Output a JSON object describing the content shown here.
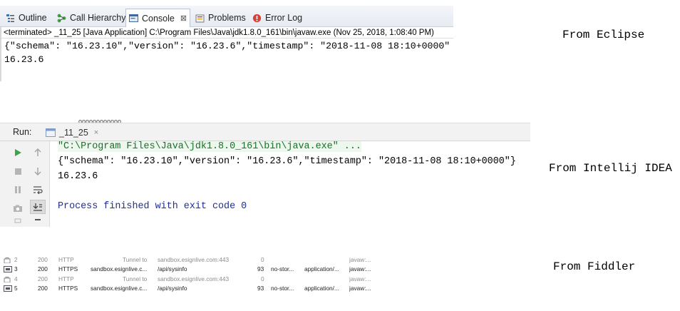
{
  "eclipse": {
    "tabs": [
      {
        "label": "Outline",
        "icon": "outline-icon",
        "active": false
      },
      {
        "label": "Call Hierarchy",
        "icon": "call-hierarchy-icon",
        "active": false
      },
      {
        "label": "Console",
        "icon": "console-icon",
        "active": true
      },
      {
        "label": "Problems",
        "icon": "problems-icon",
        "active": false
      },
      {
        "label": "Error Log",
        "icon": "error-log-icon",
        "active": false
      }
    ],
    "close_glyph": "⊠",
    "status_line": "<terminated> _11_25 [Java Application] C:\\Program Files\\Java\\jdk1.8.0_161\\bin\\javaw.exe (Nov 25, 2018, 1:08:40 PM)",
    "output": [
      "{\"schema\": \"16.23.10\",\"version\": \"16.23.6\",\"timestamp\": \"2018-11-08 18:10+0000\"",
      "16.23.6"
    ],
    "caption": "From Eclipse"
  },
  "idea": {
    "partial_text": "oooooooooooo",
    "run_label": "Run:",
    "tab_label": "_11_25",
    "tab_close": "×",
    "toolbar_icons": [
      "run-icon",
      "up-arrow-icon",
      "stop-icon",
      "down-arrow-icon",
      "pause-icon",
      "soft-wrap-icon",
      "camera-icon",
      "scroll-to-end-icon"
    ],
    "command_line": "\"C:\\Program Files\\Java\\jdk1.8.0_161\\bin\\java.exe\" ...",
    "output": [
      "{\"schema\": \"16.23.10\",\"version\": \"16.23.6\",\"timestamp\": \"2018-11-08 18:10+0000\"}",
      "16.23.6"
    ],
    "exit_line": "Process finished with exit code 0",
    "caption": "From Intellij IDEA",
    "colors": {
      "command": "#1a6f2a",
      "exit": "#1d2e9a",
      "run_green": "#3ca34a"
    }
  },
  "fiddler": {
    "rows": [
      {
        "num": "2",
        "result": "200",
        "protocol": "HTTP",
        "host": "Tunnel to",
        "url": "sandbox.esignlive.com:443",
        "body": "0",
        "caching": "",
        "content_type": "",
        "process": "javaw:...",
        "tunnel": true
      },
      {
        "num": "3",
        "result": "200",
        "protocol": "HTTPS",
        "host": "sandbox.esignlive.c...",
        "url": "/api/sysinfo",
        "body": "93",
        "caching": "no-stor...",
        "content_type": "application/...",
        "process": "javaw:...",
        "tunnel": false
      },
      {
        "num": "4",
        "result": "200",
        "protocol": "HTTP",
        "host": "Tunnel to",
        "url": "sandbox.esignlive.com:443",
        "body": "0",
        "caching": "",
        "content_type": "",
        "process": "javaw:...",
        "tunnel": true
      },
      {
        "num": "5",
        "result": "200",
        "protocol": "HTTPS",
        "host": "sandbox.esignlive.c...",
        "url": "/api/sysinfo",
        "body": "93",
        "caching": "no-stor...",
        "content_type": "application/...",
        "process": "javaw:...",
        "tunnel": false
      }
    ],
    "caption": "From Fiddler"
  }
}
